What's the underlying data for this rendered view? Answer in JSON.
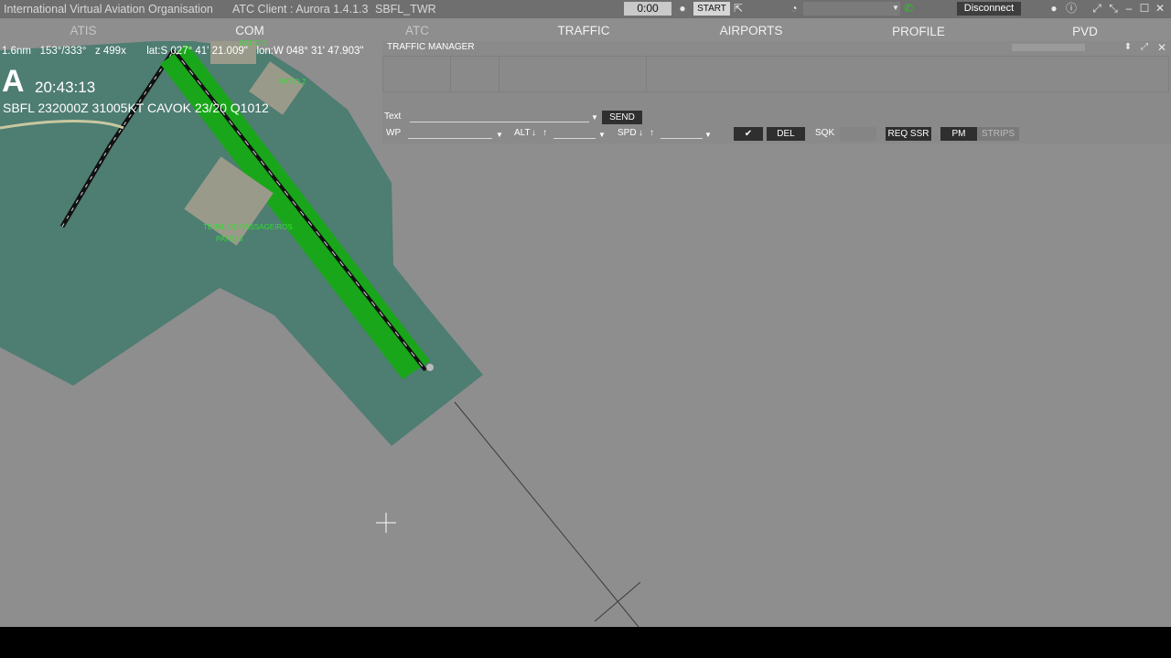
{
  "window": {
    "title": "International Virtual Aviation Organisation",
    "client": "ATC Client : Aurora 1.4.1.3",
    "station": "SBFL_TWR",
    "timer": "0:00",
    "start_label": "START",
    "disconnect_label": "Disconnect"
  },
  "menu": {
    "atis": "ATIS",
    "com": "COM",
    "atc": "ATC",
    "traffic": "TRAFFIC",
    "airports": "AIRPORTS",
    "profile": "PROFILE",
    "pvd": "PVD"
  },
  "map": {
    "range": "1.6nm",
    "heading": "153°/333°",
    "zoom": "z 499x",
    "lat": "lat:S 027° 41' 21.009\"",
    "lon": "lon:W 048° 31' 47.903\"",
    "atis_letter": "A",
    "clock": "20:43:13",
    "metar": "SBFL 232000Z 31005KT CAVOK 23/20 Q1012",
    "labels": {
      "terminal": "TERM. DE PASSAGEIROS",
      "patio3": "PATIO 3",
      "patio2": "PATIO 2",
      "patio_top": "PATIO 5"
    },
    "colors": {
      "land": "#4e7d72",
      "runway": "#1aa61a",
      "background": "#8e8e8e"
    }
  },
  "traffic_manager": {
    "title": "TRAFFIC MANAGER",
    "text_label": "Text",
    "text_value": "",
    "send_label": "SEND",
    "wp_label": "WP",
    "alt_label": "ALT",
    "spd_label": "SPD",
    "del_label": "DEL",
    "sqk_label": "SQK",
    "req_ssr_label": "REQ SSR",
    "pm_label": "PM",
    "strips_label": "STRIPS"
  }
}
